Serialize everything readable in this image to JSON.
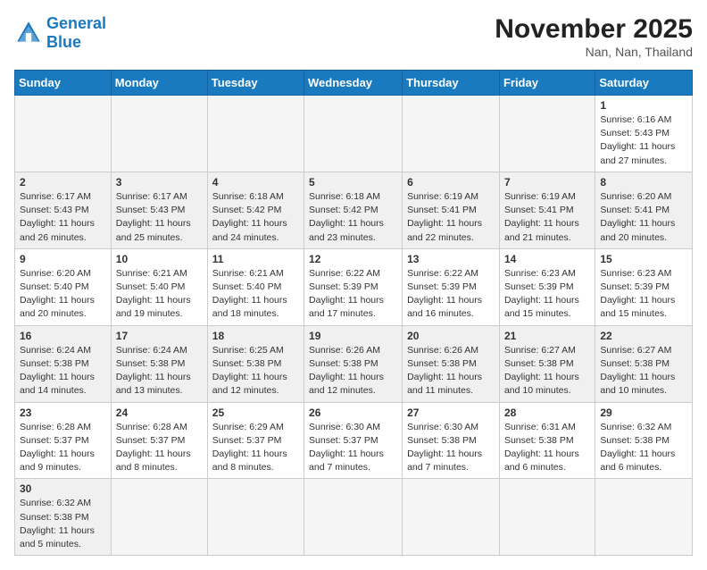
{
  "header": {
    "logo_general": "General",
    "logo_blue": "Blue",
    "month_year": "November 2025",
    "location": "Nan, Nan, Thailand"
  },
  "days_of_week": [
    "Sunday",
    "Monday",
    "Tuesday",
    "Wednesday",
    "Thursday",
    "Friday",
    "Saturday"
  ],
  "weeks": [
    [
      {
        "day": "",
        "info": ""
      },
      {
        "day": "",
        "info": ""
      },
      {
        "day": "",
        "info": ""
      },
      {
        "day": "",
        "info": ""
      },
      {
        "day": "",
        "info": ""
      },
      {
        "day": "",
        "info": ""
      },
      {
        "day": "1",
        "info": "Sunrise: 6:16 AM\nSunset: 5:43 PM\nDaylight: 11 hours\nand 27 minutes."
      }
    ],
    [
      {
        "day": "2",
        "info": "Sunrise: 6:17 AM\nSunset: 5:43 PM\nDaylight: 11 hours\nand 26 minutes."
      },
      {
        "day": "3",
        "info": "Sunrise: 6:17 AM\nSunset: 5:43 PM\nDaylight: 11 hours\nand 25 minutes."
      },
      {
        "day": "4",
        "info": "Sunrise: 6:18 AM\nSunset: 5:42 PM\nDaylight: 11 hours\nand 24 minutes."
      },
      {
        "day": "5",
        "info": "Sunrise: 6:18 AM\nSunset: 5:42 PM\nDaylight: 11 hours\nand 23 minutes."
      },
      {
        "day": "6",
        "info": "Sunrise: 6:19 AM\nSunset: 5:41 PM\nDaylight: 11 hours\nand 22 minutes."
      },
      {
        "day": "7",
        "info": "Sunrise: 6:19 AM\nSunset: 5:41 PM\nDaylight: 11 hours\nand 21 minutes."
      },
      {
        "day": "8",
        "info": "Sunrise: 6:20 AM\nSunset: 5:41 PM\nDaylight: 11 hours\nand 20 minutes."
      }
    ],
    [
      {
        "day": "9",
        "info": "Sunrise: 6:20 AM\nSunset: 5:40 PM\nDaylight: 11 hours\nand 20 minutes."
      },
      {
        "day": "10",
        "info": "Sunrise: 6:21 AM\nSunset: 5:40 PM\nDaylight: 11 hours\nand 19 minutes."
      },
      {
        "day": "11",
        "info": "Sunrise: 6:21 AM\nSunset: 5:40 PM\nDaylight: 11 hours\nand 18 minutes."
      },
      {
        "day": "12",
        "info": "Sunrise: 6:22 AM\nSunset: 5:39 PM\nDaylight: 11 hours\nand 17 minutes."
      },
      {
        "day": "13",
        "info": "Sunrise: 6:22 AM\nSunset: 5:39 PM\nDaylight: 11 hours\nand 16 minutes."
      },
      {
        "day": "14",
        "info": "Sunrise: 6:23 AM\nSunset: 5:39 PM\nDaylight: 11 hours\nand 15 minutes."
      },
      {
        "day": "15",
        "info": "Sunrise: 6:23 AM\nSunset: 5:39 PM\nDaylight: 11 hours\nand 15 minutes."
      }
    ],
    [
      {
        "day": "16",
        "info": "Sunrise: 6:24 AM\nSunset: 5:38 PM\nDaylight: 11 hours\nand 14 minutes."
      },
      {
        "day": "17",
        "info": "Sunrise: 6:24 AM\nSunset: 5:38 PM\nDaylight: 11 hours\nand 13 minutes."
      },
      {
        "day": "18",
        "info": "Sunrise: 6:25 AM\nSunset: 5:38 PM\nDaylight: 11 hours\nand 12 minutes."
      },
      {
        "day": "19",
        "info": "Sunrise: 6:26 AM\nSunset: 5:38 PM\nDaylight: 11 hours\nand 12 minutes."
      },
      {
        "day": "20",
        "info": "Sunrise: 6:26 AM\nSunset: 5:38 PM\nDaylight: 11 hours\nand 11 minutes."
      },
      {
        "day": "21",
        "info": "Sunrise: 6:27 AM\nSunset: 5:38 PM\nDaylight: 11 hours\nand 10 minutes."
      },
      {
        "day": "22",
        "info": "Sunrise: 6:27 AM\nSunset: 5:38 PM\nDaylight: 11 hours\nand 10 minutes."
      }
    ],
    [
      {
        "day": "23",
        "info": "Sunrise: 6:28 AM\nSunset: 5:37 PM\nDaylight: 11 hours\nand 9 minutes."
      },
      {
        "day": "24",
        "info": "Sunrise: 6:28 AM\nSunset: 5:37 PM\nDaylight: 11 hours\nand 8 minutes."
      },
      {
        "day": "25",
        "info": "Sunrise: 6:29 AM\nSunset: 5:37 PM\nDaylight: 11 hours\nand 8 minutes."
      },
      {
        "day": "26",
        "info": "Sunrise: 6:30 AM\nSunset: 5:37 PM\nDaylight: 11 hours\nand 7 minutes."
      },
      {
        "day": "27",
        "info": "Sunrise: 6:30 AM\nSunset: 5:38 PM\nDaylight: 11 hours\nand 7 minutes."
      },
      {
        "day": "28",
        "info": "Sunrise: 6:31 AM\nSunset: 5:38 PM\nDaylight: 11 hours\nand 6 minutes."
      },
      {
        "day": "29",
        "info": "Sunrise: 6:32 AM\nSunset: 5:38 PM\nDaylight: 11 hours\nand 6 minutes."
      }
    ],
    [
      {
        "day": "30",
        "info": "Sunrise: 6:32 AM\nSunset: 5:38 PM\nDaylight: 11 hours\nand 5 minutes."
      },
      {
        "day": "",
        "info": ""
      },
      {
        "day": "",
        "info": ""
      },
      {
        "day": "",
        "info": ""
      },
      {
        "day": "",
        "info": ""
      },
      {
        "day": "",
        "info": ""
      },
      {
        "day": "",
        "info": ""
      }
    ]
  ]
}
